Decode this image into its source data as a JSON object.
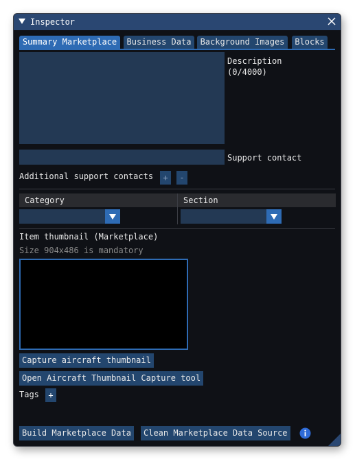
{
  "window": {
    "title": "Inspector"
  },
  "tabs": [
    {
      "label": "Summary Marketplace",
      "active": true
    },
    {
      "label": "Business Data"
    },
    {
      "label": "Background Images"
    },
    {
      "label": "Blocks"
    }
  ],
  "description": {
    "label": "Description\n(0/4000)",
    "value": ""
  },
  "support_contact": {
    "label": "Support contact",
    "value": ""
  },
  "additional_contacts": {
    "label": "Additional support contacts",
    "add_label": "+",
    "remove_label": "-"
  },
  "category": {
    "label": "Category",
    "value": ""
  },
  "section": {
    "label": "Section",
    "value": ""
  },
  "thumbnail": {
    "label": "Item thumbnail (Marketplace)",
    "hint": "Size 904x486 is mandatory"
  },
  "buttons": {
    "capture": "Capture aircraft thumbnail",
    "open_tool": "Open Aircraft Thumbnail Capture tool",
    "build": "Build Marketplace Data",
    "clean": "Clean Marketplace Data Source"
  },
  "tags": {
    "label": "Tags",
    "add_label": "+"
  },
  "colors": {
    "title_bar": "#2a4772",
    "accent": "#2e6bb4",
    "field": "#233954",
    "background": "#0f1116"
  }
}
